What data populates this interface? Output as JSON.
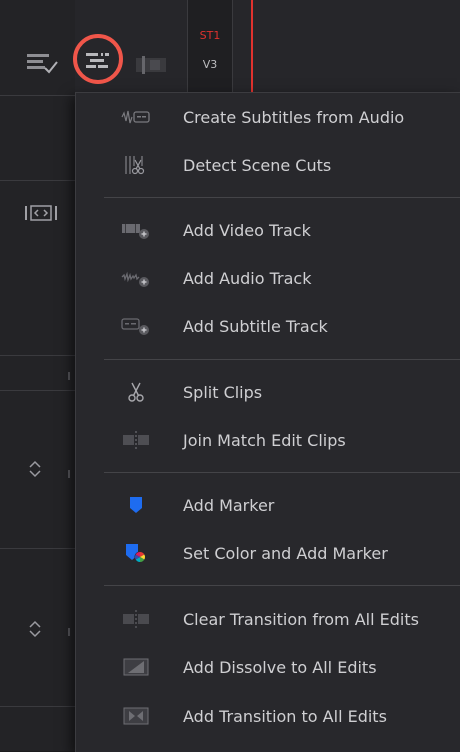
{
  "toolbar": {
    "icons": [
      "timeline-view-options-icon",
      "track-options-icon",
      "clip-view-icon"
    ]
  },
  "tracks": {
    "subtitle_label": "ST1",
    "video_label": "V3"
  },
  "colors": {
    "accent_red": "#e0322e",
    "highlight_ring": "#f0564a",
    "marker_blue": "#1e6cf0"
  },
  "menu": {
    "items": [
      {
        "label": "Create Subtitles from Audio",
        "icon": "subtitles-from-audio-icon"
      },
      {
        "label": "Detect Scene Cuts",
        "icon": "scene-cut-icon"
      },
      {
        "label": "Add Video Track",
        "icon": "add-video-track-icon"
      },
      {
        "label": "Add Audio Track",
        "icon": "add-audio-track-icon"
      },
      {
        "label": "Add Subtitle Track",
        "icon": "add-subtitle-track-icon"
      },
      {
        "label": "Split Clips",
        "icon": "scissors-icon"
      },
      {
        "label": "Join Match Edit Clips",
        "icon": "join-clips-icon"
      },
      {
        "label": "Add Marker",
        "icon": "marker-icon"
      },
      {
        "label": "Set Color and Add Marker",
        "icon": "color-marker-icon"
      },
      {
        "label": "Clear Transition from All Edits",
        "icon": "clear-transition-icon"
      },
      {
        "label": "Add Dissolve to All Edits",
        "icon": "dissolve-icon"
      },
      {
        "label": "Add Transition to All Edits",
        "icon": "transition-icon"
      }
    ]
  }
}
